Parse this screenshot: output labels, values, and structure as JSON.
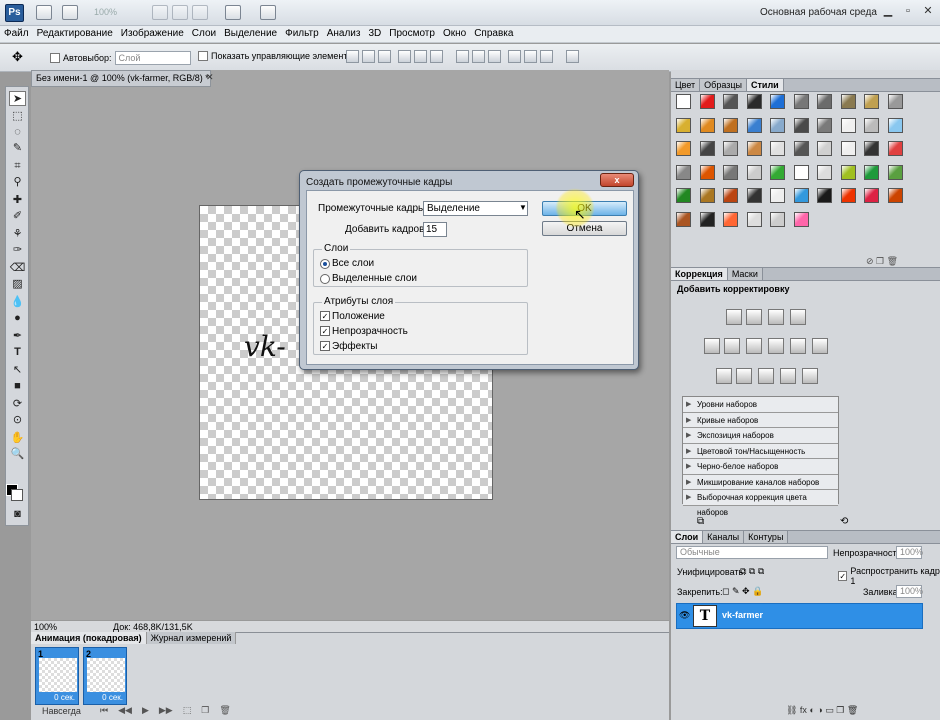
{
  "app": {
    "logo": "Ps",
    "zoom": "100%",
    "workspace": "Основная рабочая среда"
  },
  "menu": [
    "Файл",
    "Редактирование",
    "Изображение",
    "Слои",
    "Выделение",
    "Фильтр",
    "Анализ",
    "3D",
    "Просмотр",
    "Окно",
    "Справка"
  ],
  "options": {
    "autoselect": "Автовыбор:",
    "autoselect_value": "Слой",
    "show_controls": "Показать управляющие элементы"
  },
  "document": {
    "tab_title": "Без имени-1 @ 100% (vk-farmer, RGB/8) *",
    "canvas_text": "vk-",
    "status_zoom": "100%",
    "status_doc": "Док: 468,8K/131,5K"
  },
  "animation": {
    "tabs": [
      "Анимация (покадровая)",
      "Журнал измерений"
    ],
    "frames": [
      {
        "num": "1",
        "delay": "0 сек."
      },
      {
        "num": "2",
        "delay": "0 сек."
      }
    ],
    "loop": "Навсегда"
  },
  "panels": {
    "swatch_tabs": [
      "Цвет",
      "Образцы",
      "Стили"
    ],
    "adjust_tabs": [
      "Коррекция",
      "Маски"
    ],
    "adjust_title": "Добавить корректировку",
    "presets": [
      "Уровни наборов",
      "Кривые наборов",
      "Экспозиция наборов",
      "Цветовой тон/Насыщенность наборов",
      "Черно-белое наборов",
      "Микширование каналов наборов",
      "Выборочная коррекция цвета наборов"
    ],
    "layers_tabs": [
      "Слои",
      "Каналы",
      "Контуры"
    ],
    "blend_mode": "Обычные",
    "opacity_label": "Непрозрачность:",
    "opacity_value": "100%",
    "unify_label": "Унифицировать:",
    "propagate_label": "Распространить кадр 1",
    "lock_label": "Закрепить:",
    "fill_label": "Заливка:",
    "fill_value": "100%",
    "layer_name": "vk-farmer",
    "layer_thumb": "T"
  },
  "dialog": {
    "title": "Создать промежуточные кадры",
    "close": "x",
    "tween_label": "Промежуточные кадры:",
    "tween_value": "Выделение",
    "frames_label": "Добавить кадров:",
    "frames_value": "15",
    "layers_group": "Слои",
    "radio_all": "Все слои",
    "radio_selected": "Выделенные слои",
    "attr_group": "Атрибуты слоя",
    "chk_position": "Положение",
    "chk_opacity": "Непрозрачность",
    "chk_effects": "Эффекты",
    "ok": "OK",
    "cancel": "Отмена"
  },
  "colors": {
    "accent": "#2f8fe6",
    "swatches": [
      "#ffffff",
      "#e21b1b",
      "#555555",
      "#2a2a2a",
      "#1e6fd6",
      "#777777",
      "#6b6b6b",
      "#8a7a50",
      "#c0a050",
      "#999999",
      "#d8b030",
      "#e08a20",
      "#c07020",
      "#3a7fd0",
      "#88aacc",
      "#4a4a4a",
      "#7a7a7a",
      "#f0f0f0",
      "#bbbbbb",
      "#8ac8f0",
      "#f29a2a",
      "#444444",
      "#aaaaaa",
      "#cc8844",
      "#e0e0e0",
      "#555555",
      "#d0d0d0",
      "#efefef",
      "#333333",
      "#e04040",
      "#888888",
      "#dd5500",
      "#777777",
      "#cccccc",
      "#33aa33",
      "#ffffff",
      "#dddddd",
      "#a0c020",
      "#1e9a3a",
      "#5aa040",
      "#228822",
      "#aa7722",
      "#bb4411",
      "#333333",
      "#eeeeee",
      "#3399dd",
      "#1a1a1a",
      "#ee3300",
      "#dd2244",
      "#cc4400",
      "#aa5522",
      "#222222",
      "#ff6633",
      "#dddddd",
      "#cccccc",
      "#ff66aa"
    ]
  }
}
